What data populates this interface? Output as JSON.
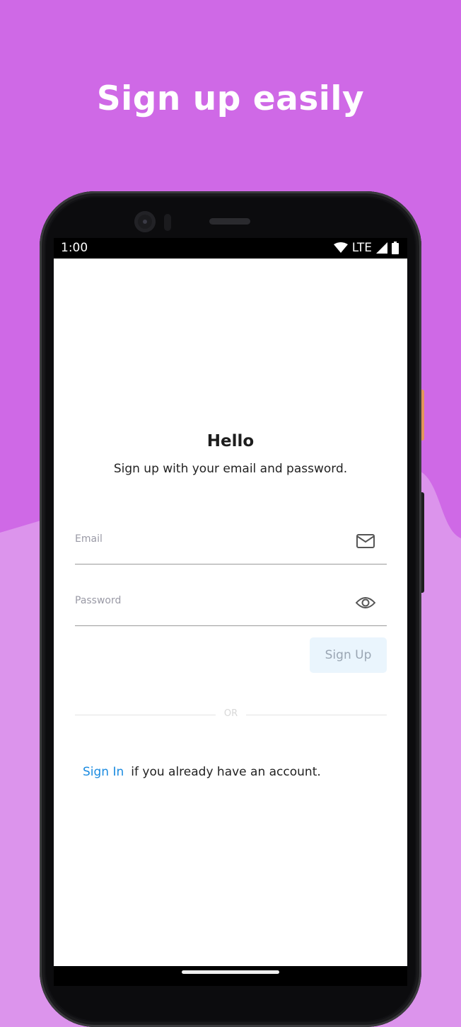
{
  "headline": "Sign up easily",
  "colors": {
    "background_top": "#cf69e6",
    "background_bottom": "#dc94ec",
    "accent_link": "#1b8be0",
    "button_bg": "#eaf5fd"
  },
  "status_bar": {
    "time": "1:00",
    "network": "LTE",
    "icons": [
      "wifi-icon",
      "cell-signal-icon",
      "battery-icon"
    ]
  },
  "screen": {
    "title": "Hello",
    "subtitle": "Sign up with your email and password.",
    "email": {
      "placeholder": "Email",
      "value": "",
      "icon": "mail-icon"
    },
    "password": {
      "placeholder": "Password",
      "value": "",
      "icon": "eye-icon"
    },
    "signup_button": "Sign Up",
    "divider_text": "OR",
    "signin_link": "Sign In",
    "signin_text": "if you already have an account."
  }
}
